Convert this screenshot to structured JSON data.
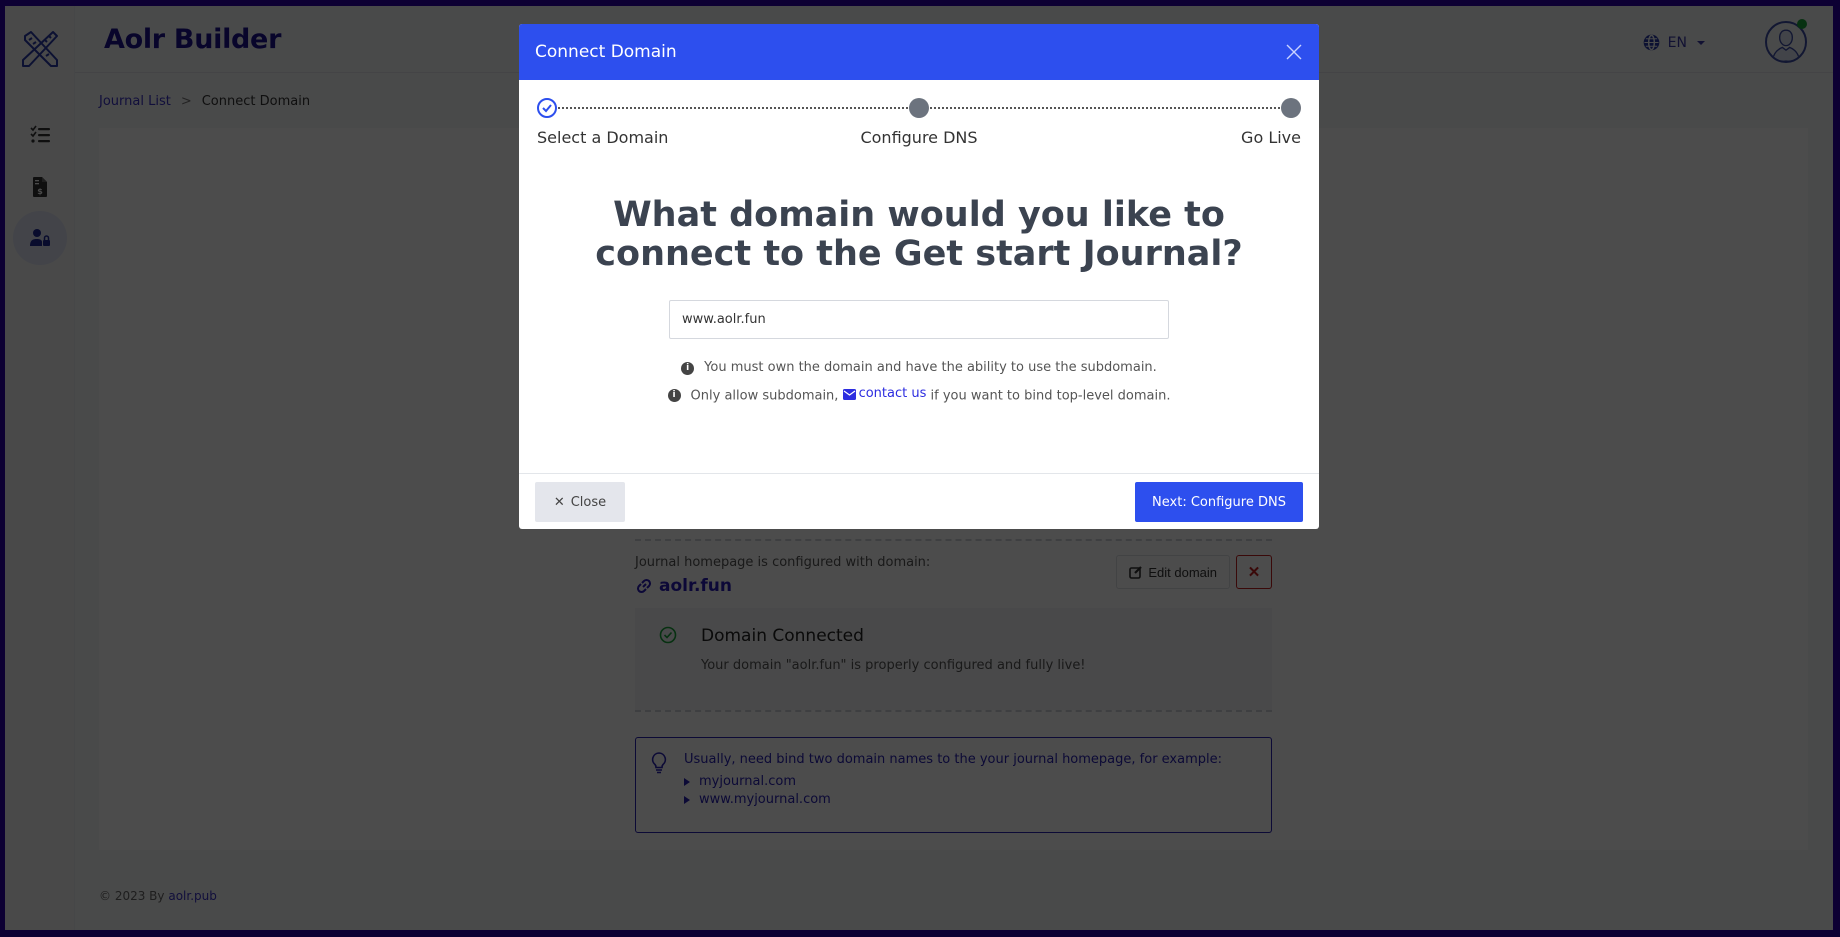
{
  "app": {
    "title": "Aolr Builder"
  },
  "sidebar": {
    "items": [
      {
        "name": "checklist",
        "icon": "list-check-icon",
        "active": false
      },
      {
        "name": "invoice",
        "icon": "file-invoice-dollar-icon",
        "active": false
      },
      {
        "name": "user-lock",
        "icon": "user-lock-icon",
        "active": true
      }
    ]
  },
  "topbar": {
    "language": "EN",
    "online": true
  },
  "breadcrumb": {
    "items": [
      "Journal List",
      "Connect Domain"
    ],
    "separator": ">"
  },
  "page": {
    "configured_label": "Journal homepage is configured with domain:",
    "configured_domain": "aolr.fun",
    "edit_domain_label": "Edit domain",
    "delete_label": "✕",
    "status_title": "Domain Connected",
    "status_text": "Your domain \"aolr.fun\" is properly configured and fully live!",
    "tip_text": "Usually, need bind two domain names to the your journal homepage, for example:",
    "tip_examples": [
      "myjournal.com",
      "www.myjournal.com"
    ]
  },
  "footer": {
    "copyright": "© 2023 By",
    "link": "aolr.pub"
  },
  "modal": {
    "title": "Connect Domain",
    "steps": [
      {
        "label": "Select a Domain",
        "state": "done"
      },
      {
        "label": "Configure DNS",
        "state": "pending"
      },
      {
        "label": "Go Live",
        "state": "pending"
      }
    ],
    "heading": "What domain would you like to connect to the Get start Journal?",
    "domain_input": {
      "value": "www.aolr.fun",
      "placeholder": ""
    },
    "info1": "You must own the domain and have the ability to use the subdomain.",
    "info2_prefix": "Only allow subdomain,",
    "info2_link": "contact us",
    "info2_suffix": "if you want to bind top-level domain.",
    "close_label": "Close",
    "next_label": "Next: Configure DNS"
  },
  "colors": {
    "primary": "#2d4fee",
    "brand": "#1c1190",
    "success": "#1aa33b",
    "danger": "#c42121",
    "frame": "#0d0033"
  }
}
